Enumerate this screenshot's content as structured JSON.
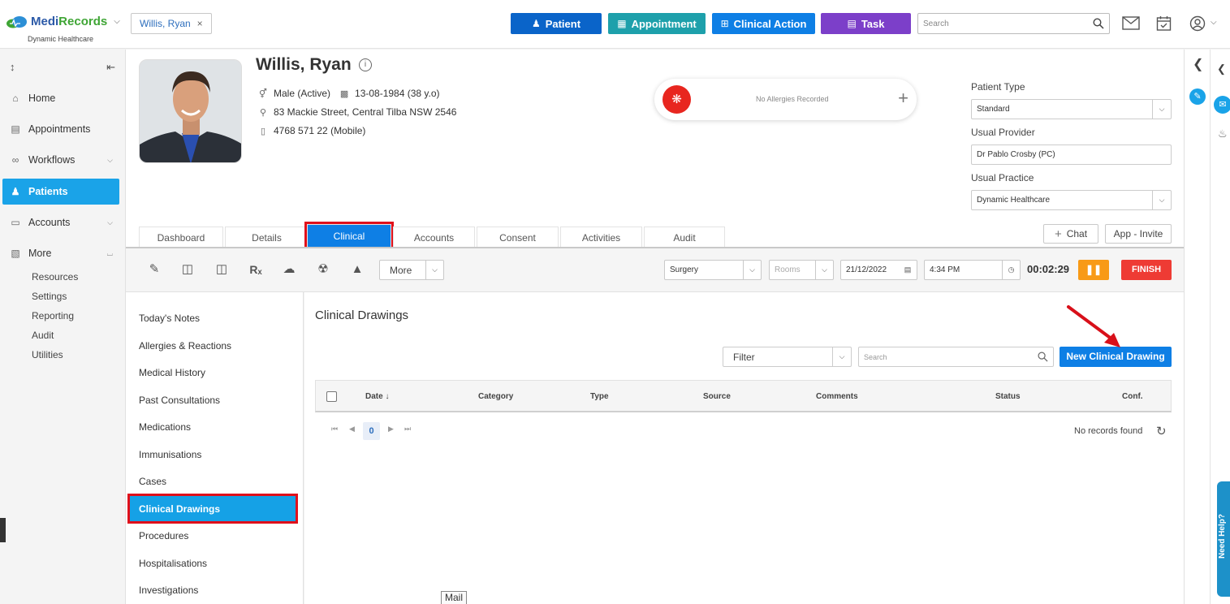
{
  "brand": {
    "name_blue": "Medi",
    "name_green": "Records",
    "subtitle": "Dynamic Healthcare"
  },
  "patient_chip": {
    "label": "Willis, Ryan",
    "close": "×"
  },
  "top_actions": [
    {
      "label": "Patient",
      "icon": "person-plus-icon",
      "color": "#0a64c9"
    },
    {
      "label": "Appointment",
      "icon": "calendar-icon",
      "color": "#1ea0ab"
    },
    {
      "label": "Clinical Action",
      "icon": "medkit-icon",
      "color": "#0e7fe5"
    },
    {
      "label": "Task",
      "icon": "clipboard-icon",
      "color": "#7c3fc9"
    }
  ],
  "global_search": {
    "placeholder": "Search"
  },
  "left_nav": {
    "items": [
      {
        "label": "Home"
      },
      {
        "label": "Appointments"
      },
      {
        "label": "Workflows"
      },
      {
        "label": "Patients"
      },
      {
        "label": "Accounts"
      },
      {
        "label": "More"
      }
    ],
    "sub_items": [
      "Resources",
      "Settings",
      "Reporting",
      "Audit",
      "Utilities"
    ]
  },
  "patient": {
    "name": "Willis, Ryan",
    "gender": "Male (Active)",
    "dob": "13-08-1984 (38 y.o)",
    "address": "83 Mackie Street, Central Tilba NSW 2546",
    "phone": "4768 571 22 (Mobile)"
  },
  "allergy": {
    "text": "No Allergies Recorded"
  },
  "patient_fields": {
    "type_label": "Patient Type",
    "type_value": "Standard",
    "provider_label": "Usual Provider",
    "provider_value": "Dr Pablo Crosby (PC)",
    "practice_label": "Usual Practice",
    "practice_value": "Dynamic Healthcare"
  },
  "tabs": [
    "Dashboard",
    "Details",
    "Clinical",
    "Accounts",
    "Consent",
    "Activities",
    "Audit"
  ],
  "header_buttons": {
    "chat": "Chat",
    "app_invite": "App - Invite"
  },
  "toolbar": {
    "more": "More",
    "location": "Surgery",
    "rooms": "Rooms",
    "date": "21/12/2022",
    "time": "4:34 PM",
    "timer": "00:02:29",
    "finish": "FINISH"
  },
  "clinical_menu": [
    "Today's Notes",
    "Allergies & Reactions",
    "Medical History",
    "Past Consultations",
    "Medications",
    "Immunisations",
    "Cases",
    "Clinical Drawings",
    "Procedures",
    "Hospitalisations",
    "Investigations"
  ],
  "content": {
    "title": "Clinical Drawings",
    "filter": "Filter",
    "search_placeholder": "Search",
    "new_button": "New Clinical Drawing",
    "columns": [
      "Date",
      "Category",
      "Type",
      "Source",
      "Comments",
      "Status",
      "Conf."
    ],
    "page": "0",
    "no_records": "No records found"
  },
  "tooltip": {
    "text": "Mail"
  },
  "help_tab": {
    "text": "Need Help?"
  }
}
